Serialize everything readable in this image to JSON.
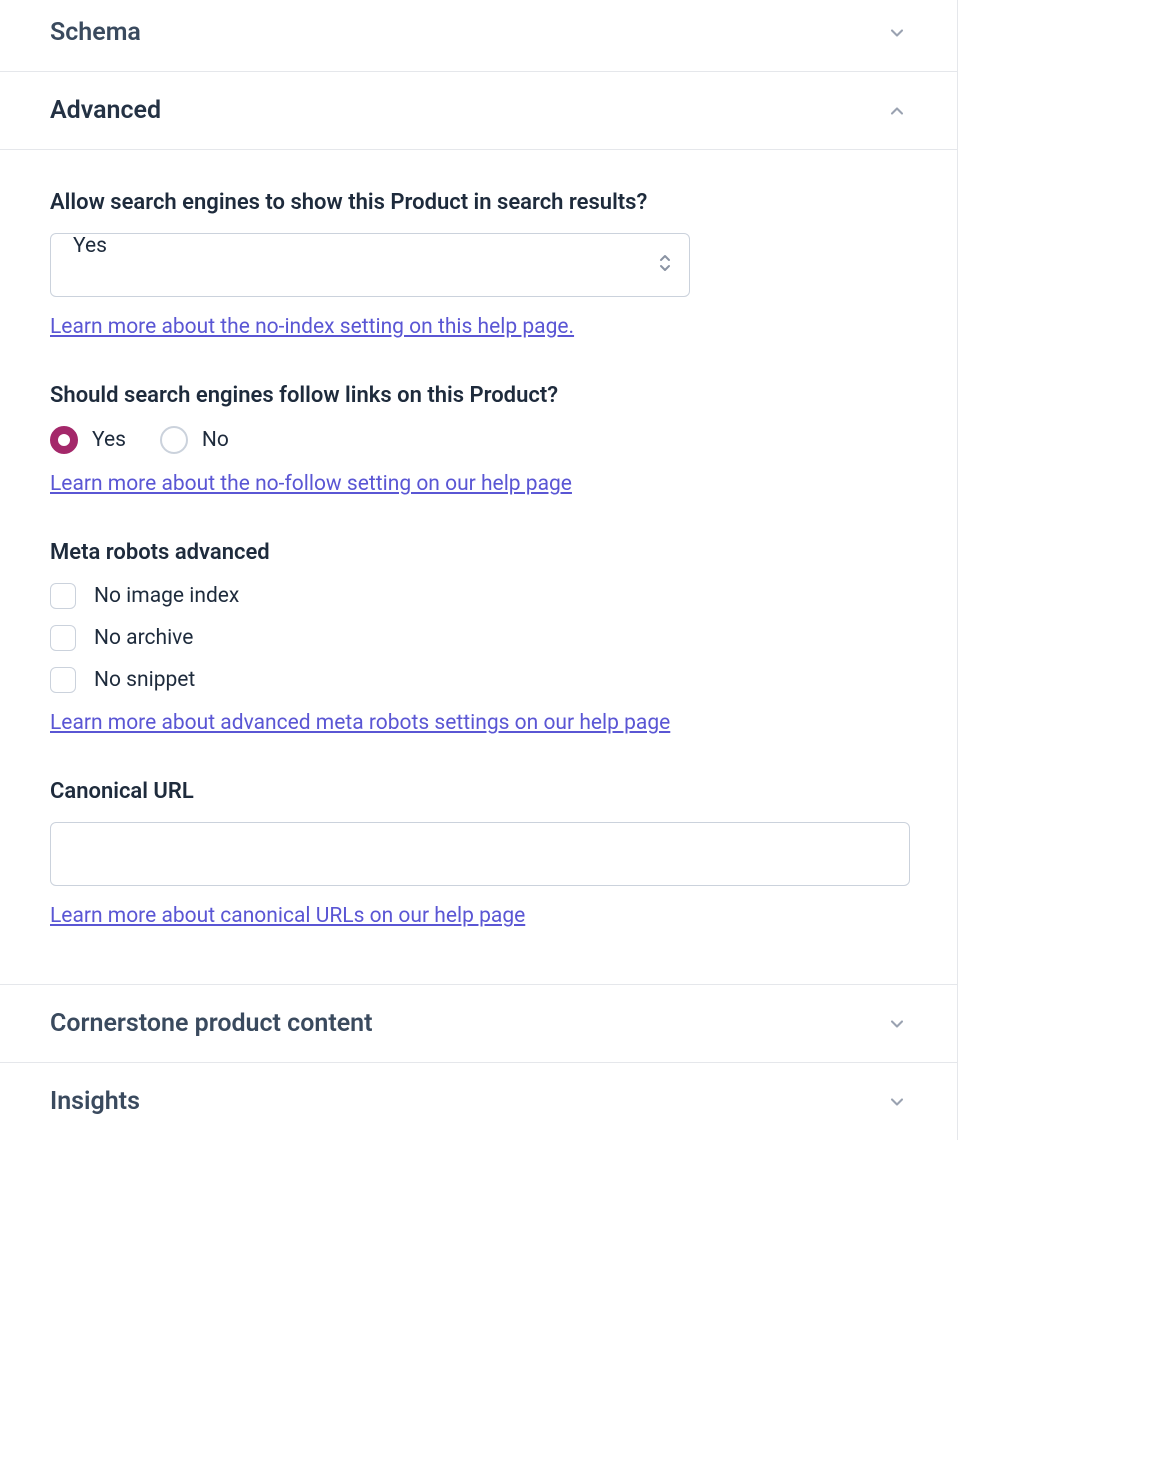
{
  "sections": {
    "schema": {
      "title": "Schema"
    },
    "advanced": {
      "title": "Advanced"
    },
    "cornerstone": {
      "title": "Cornerstone product content"
    },
    "insights": {
      "title": "Insights"
    }
  },
  "advanced_panel": {
    "allow_search": {
      "label": "Allow search engines to show this Product in search results?",
      "value": "Yes",
      "help": "Learn more about the no-index setting on this help page."
    },
    "follow_links": {
      "label": "Should search engines follow links on this Product?",
      "yes_label": "Yes",
      "no_label": "No",
      "selected": "yes",
      "help": "Learn more about the no-follow setting on our help page"
    },
    "meta_robots": {
      "label": "Meta robots advanced",
      "options": [
        {
          "label": "No image index"
        },
        {
          "label": "No archive"
        },
        {
          "label": "No snippet"
        }
      ],
      "help": "Learn more about advanced meta robots settings on our help page"
    },
    "canonical": {
      "label": "Canonical URL",
      "value": "",
      "help": "Learn more about canonical URLs on our help page"
    }
  }
}
